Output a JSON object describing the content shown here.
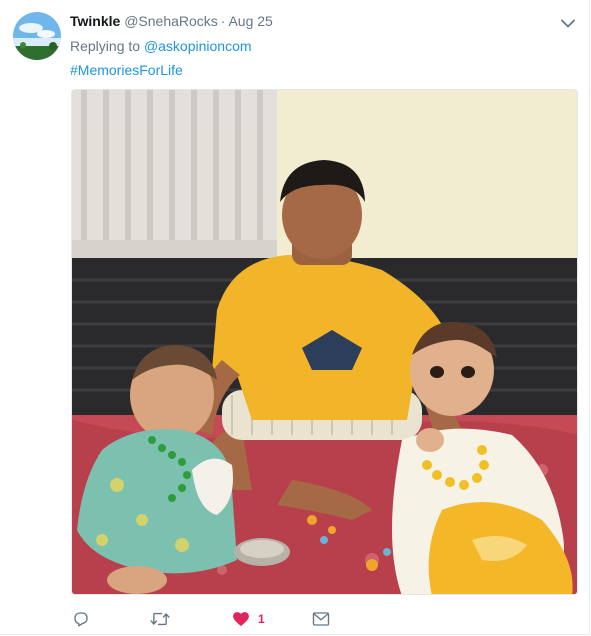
{
  "tweet": {
    "display_name": "Twinkle",
    "handle": "@SnehaRocks",
    "separator": "·",
    "date": "Aug 25",
    "replying_prefix": "Replying to",
    "replying_to": "@askopinioncom",
    "hashtag": "#MemoriesForLife",
    "like_count": "1"
  },
  "icons": {
    "caret": "chevron-down-icon",
    "reply": "reply-icon",
    "retweet": "retweet-icon",
    "like": "heart-icon",
    "dm": "mail-icon"
  },
  "colors": {
    "link": "#1b95e0",
    "muted": "#657786",
    "like_active": "#e0245e"
  }
}
